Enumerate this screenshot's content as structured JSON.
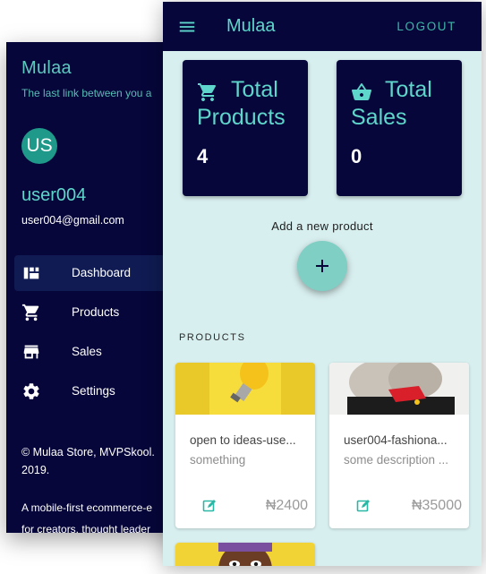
{
  "drawer": {
    "title": "Mulaa",
    "tagline": "The last link between you a",
    "avatar_initials": "US",
    "username": "user004",
    "email": "user004@gmail.com",
    "items": [
      {
        "label": "Dashboard",
        "icon": "dashboard-icon",
        "active": true
      },
      {
        "label": "Products",
        "icon": "cart-icon",
        "active": false
      },
      {
        "label": "Sales",
        "icon": "store-icon",
        "active": false
      },
      {
        "label": "Settings",
        "icon": "gear-icon",
        "active": false
      }
    ],
    "footer_copyright": "© Mulaa Store, MVPSkool. 2019.",
    "footer_description_line1": "A mobile-first ecommerce-e",
    "footer_description_line2": "for creators, thought leader"
  },
  "appbar": {
    "title": "Mulaa",
    "logout_label": "LOGOUT"
  },
  "stats": [
    {
      "title": "Total Products",
      "value": "4",
      "icon": "cart-icon"
    },
    {
      "title": "Total Sales",
      "value": "0",
      "icon": "basket-icon"
    }
  ],
  "add_product_text": "Add a new product",
  "products_section_label": "PRODUCTS",
  "products": [
    {
      "name": "open to ideas-use...",
      "description": "something",
      "price": "₦2400",
      "image": "lightbulb-photo"
    },
    {
      "name": "user004-fashiona...",
      "description": "some description ...",
      "price": "₦35000",
      "image": "fashion-photo"
    },
    {
      "name": "",
      "description": "",
      "price": "",
      "image": "face-photo"
    }
  ],
  "colors": {
    "navy": "#06063a",
    "teal_text": "#5fd6cb",
    "fab": "#7fcfc4",
    "background": "#d8efef"
  }
}
